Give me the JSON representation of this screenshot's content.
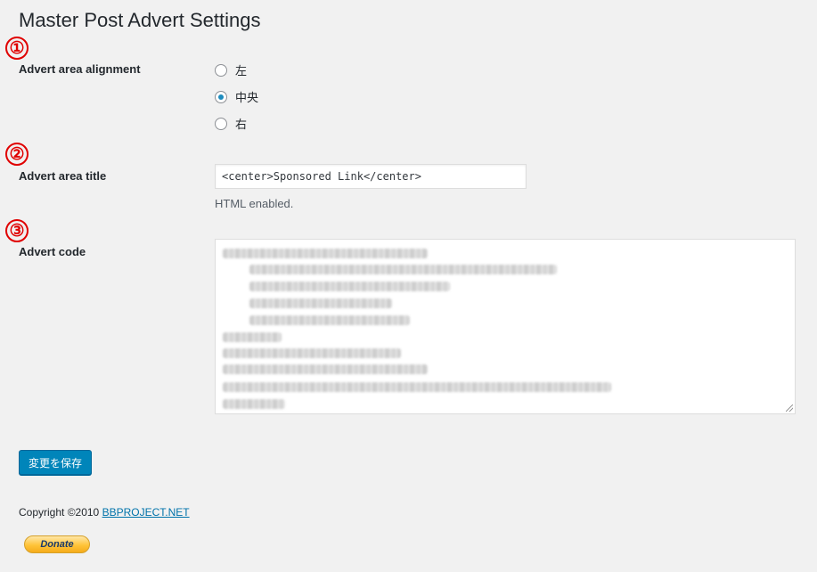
{
  "page": {
    "title": "Master Post Advert Settings"
  },
  "markers": [
    "①",
    "②",
    "③"
  ],
  "alignment": {
    "label": "Advert area alignment",
    "options": [
      {
        "label": "左",
        "checked": false
      },
      {
        "label": "中央",
        "checked": true
      },
      {
        "label": "右",
        "checked": false
      }
    ]
  },
  "title_field": {
    "label": "Advert area title",
    "value": "<center>Sponsored Link</center>",
    "help": "HTML enabled."
  },
  "code_field": {
    "label": "Advert code",
    "content_state": "blurred / obscured"
  },
  "save_button": {
    "label": "変更を保存"
  },
  "footer": {
    "copyright_prefix": "Copyright ©2010 ",
    "link_text": "BBPROJECT.NET",
    "donate_label": "Donate"
  },
  "colors": {
    "accent": "#0085ba",
    "marker": "#e00000",
    "link": "#0073aa"
  }
}
